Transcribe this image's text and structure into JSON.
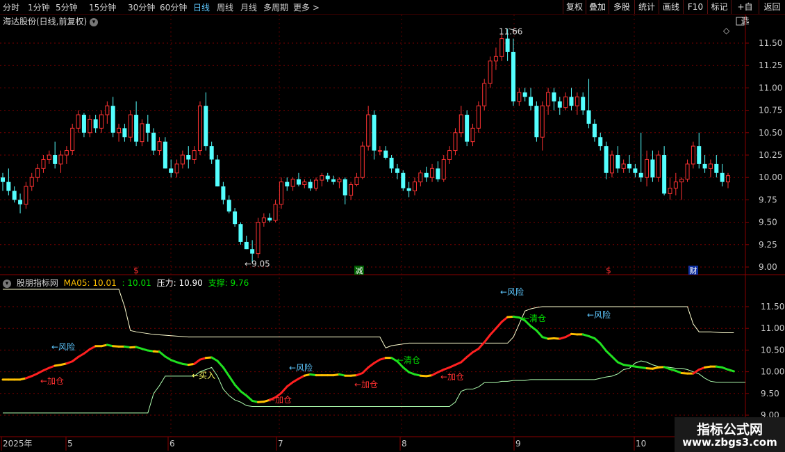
{
  "toolbar": {
    "periods": [
      {
        "label": "分时",
        "active": false
      },
      {
        "label": "1分钟",
        "active": false
      },
      {
        "label": "5分钟",
        "active": false
      },
      {
        "label": "15分钟",
        "active": false
      },
      {
        "label": "30分钟",
        "active": false
      },
      {
        "label": "60分钟",
        "active": false
      },
      {
        "label": "日线",
        "active": true
      },
      {
        "label": "周线",
        "active": false
      },
      {
        "label": "月线",
        "active": false
      },
      {
        "label": "多周期",
        "active": false
      },
      {
        "label": "更多 >",
        "active": false
      }
    ],
    "right_buttons": [
      "复权",
      "叠加",
      "多股",
      "统计",
      "画线",
      "F10",
      "标记",
      "+自选",
      "返回"
    ]
  },
  "main_chart": {
    "title": "海达股份(日线,前复权)",
    "y_ticks": [
      "11.50",
      "11.25",
      "11.00",
      "10.75",
      "10.50",
      "10.25",
      "10.00",
      "9.75",
      "9.50",
      "9.25",
      "9.00"
    ],
    "high_label": "11.66",
    "low_label": "9.05",
    "markers": [
      {
        "text": "$",
        "color": "#ff3030"
      },
      {
        "text": "减",
        "color": "#00c000"
      },
      {
        "text": "$",
        "color": "#ff3030"
      },
      {
        "text": "财",
        "color": "#3070ff"
      }
    ]
  },
  "indicator": {
    "name": "股朋指标网",
    "ma_label": "MA05: 10.01",
    "ma_value2": ": 10.01",
    "pressure_label": "压力: 10.90",
    "support_label": "支撑: 9.76",
    "y_ticks": [
      "11.50",
      "11.00",
      "10.50",
      "10.00",
      "9.50",
      "9.00"
    ],
    "annotations": [
      {
        "text": "←风险",
        "color": "#5ec8ff"
      },
      {
        "text": "←加仓",
        "color": "#ff3030"
      },
      {
        "text": "←买入",
        "color": "#ffff60"
      },
      {
        "text": "←加仓",
        "color": "#ff3030"
      },
      {
        "text": "←风险",
        "color": "#5ec8ff"
      },
      {
        "text": "←加仓",
        "color": "#ff3030"
      },
      {
        "text": "←清仓",
        "color": "#00e000"
      },
      {
        "text": "←加仓",
        "color": "#ff3030"
      },
      {
        "text": "←风险",
        "color": "#5ec8ff"
      },
      {
        "text": "←清仓",
        "color": "#00e000"
      },
      {
        "text": "←风险",
        "color": "#5ec8ff"
      }
    ]
  },
  "x_axis": [
    "2025年",
    "5",
    "6",
    "7",
    "8",
    "9",
    "10"
  ],
  "watermark": {
    "line1": "指标公式网",
    "line2": "www.zbgs3.com"
  },
  "colors": {
    "up": "#ff3232",
    "down": "#54ffff",
    "grid": "#7a0000",
    "pressure": "#ffffd0",
    "support": "#b0ffb0"
  },
  "chart_data": {
    "type": "candlestick",
    "ylim": [
      8.95,
      11.72
    ],
    "candles": [
      [
        10.0,
        10.05,
        9.85,
        9.95
      ],
      [
        9.95,
        10.1,
        9.8,
        9.85
      ],
      [
        9.85,
        9.9,
        9.72,
        9.75
      ],
      [
        9.75,
        9.82,
        9.6,
        9.7
      ],
      [
        9.7,
        9.95,
        9.65,
        9.9
      ],
      [
        9.9,
        10.05,
        9.85,
        10.0
      ],
      [
        10.0,
        10.15,
        9.95,
        10.1
      ],
      [
        10.1,
        10.25,
        10.05,
        10.2
      ],
      [
        10.2,
        10.3,
        10.15,
        10.25
      ],
      [
        10.25,
        10.4,
        10.1,
        10.15
      ],
      [
        10.15,
        10.3,
        10.05,
        10.25
      ],
      [
        10.25,
        10.35,
        10.15,
        10.3
      ],
      [
        10.3,
        10.6,
        10.25,
        10.55
      ],
      [
        10.55,
        10.75,
        10.5,
        10.7
      ],
      [
        10.7,
        10.72,
        10.45,
        10.5
      ],
      [
        10.5,
        10.7,
        10.45,
        10.65
      ],
      [
        10.65,
        10.7,
        10.5,
        10.55
      ],
      [
        10.55,
        10.75,
        10.5,
        10.7
      ],
      [
        10.7,
        10.85,
        10.6,
        10.8
      ],
      [
        10.8,
        10.9,
        10.45,
        10.5
      ],
      [
        10.5,
        10.6,
        10.4,
        10.55
      ],
      [
        10.55,
        10.6,
        10.4,
        10.45
      ],
      [
        10.45,
        10.75,
        10.4,
        10.7
      ],
      [
        10.7,
        10.85,
        10.35,
        10.4
      ],
      [
        10.4,
        10.65,
        10.35,
        10.6
      ],
      [
        10.6,
        10.7,
        10.4,
        10.5
      ],
      [
        10.5,
        10.55,
        10.25,
        10.3
      ],
      [
        10.3,
        10.45,
        10.25,
        10.4
      ],
      [
        10.4,
        10.45,
        10.1,
        10.1
      ],
      [
        10.1,
        10.2,
        10.0,
        10.05
      ],
      [
        10.05,
        10.2,
        10.0,
        10.15
      ],
      [
        10.15,
        10.3,
        10.1,
        10.25
      ],
      [
        10.25,
        10.35,
        10.1,
        10.2
      ],
      [
        10.2,
        10.35,
        10.15,
        10.3
      ],
      [
        10.3,
        10.85,
        10.25,
        10.8
      ],
      [
        10.8,
        10.95,
        10.3,
        10.35
      ],
      [
        10.35,
        10.4,
        10.15,
        10.2
      ],
      [
        10.2,
        10.25,
        9.9,
        9.9
      ],
      [
        9.9,
        9.95,
        9.7,
        9.75
      ],
      [
        9.75,
        9.8,
        9.6,
        9.62
      ],
      [
        9.62,
        9.66,
        9.45,
        9.48
      ],
      [
        9.48,
        9.5,
        9.25,
        9.28
      ],
      [
        9.28,
        9.35,
        9.2,
        9.2
      ],
      [
        9.2,
        9.3,
        9.05,
        9.15
      ],
      [
        9.15,
        9.55,
        9.1,
        9.5
      ],
      [
        9.5,
        9.6,
        9.45,
        9.55
      ],
      [
        9.55,
        9.6,
        9.5,
        9.52
      ],
      [
        9.52,
        9.75,
        9.5,
        9.7
      ],
      [
        9.7,
        10.0,
        9.65,
        9.95
      ],
      [
        9.95,
        10.0,
        9.85,
        9.9
      ],
      [
        9.9,
        10.0,
        9.85,
        9.98
      ],
      [
        9.98,
        10.05,
        9.9,
        9.92
      ],
      [
        9.92,
        9.98,
        9.88,
        9.95
      ],
      [
        9.95,
        9.98,
        9.85,
        9.88
      ],
      [
        9.88,
        10.0,
        9.85,
        9.97
      ],
      [
        9.97,
        10.05,
        9.9,
        10.02
      ],
      [
        10.02,
        10.05,
        9.95,
        9.98
      ],
      [
        9.98,
        10.02,
        9.92,
        9.95
      ],
      [
        9.95,
        10.0,
        9.88,
        9.98
      ],
      [
        9.98,
        10.0,
        9.7,
        9.8
      ],
      [
        9.8,
        9.95,
        9.75,
        9.92
      ],
      [
        9.92,
        10.05,
        9.9,
        10.0
      ],
      [
        10.0,
        10.4,
        9.98,
        10.35
      ],
      [
        10.35,
        10.8,
        10.3,
        10.7
      ],
      [
        10.7,
        10.75,
        10.2,
        10.3
      ],
      [
        10.3,
        10.35,
        10.25,
        10.3
      ],
      [
        10.3,
        10.35,
        10.2,
        10.22
      ],
      [
        10.22,
        10.25,
        10.05,
        10.1
      ],
      [
        10.1,
        10.15,
        9.98,
        10.05
      ],
      [
        10.05,
        10.08,
        9.85,
        9.88
      ],
      [
        9.88,
        9.95,
        9.78,
        9.85
      ],
      [
        9.85,
        10.0,
        9.8,
        9.95
      ],
      [
        9.95,
        10.08,
        9.9,
        10.05
      ],
      [
        10.05,
        10.12,
        9.95,
        10.0
      ],
      [
        10.0,
        10.15,
        9.95,
        10.1
      ],
      [
        10.1,
        10.18,
        9.95,
        9.98
      ],
      [
        9.98,
        10.25,
        9.95,
        10.2
      ],
      [
        10.2,
        10.35,
        10.15,
        10.3
      ],
      [
        10.3,
        10.55,
        10.25,
        10.5
      ],
      [
        10.5,
        10.8,
        10.45,
        10.7
      ],
      [
        10.7,
        10.75,
        10.35,
        10.4
      ],
      [
        10.4,
        10.6,
        10.35,
        10.55
      ],
      [
        10.55,
        10.85,
        10.5,
        10.8
      ],
      [
        10.8,
        11.1,
        10.75,
        11.05
      ],
      [
        11.05,
        11.35,
        11.0,
        11.3
      ],
      [
        11.3,
        11.45,
        11.2,
        11.35
      ],
      [
        11.35,
        11.6,
        11.3,
        11.55
      ],
      [
        11.55,
        11.66,
        11.3,
        11.4
      ],
      [
        11.4,
        11.55,
        10.8,
        10.85
      ],
      [
        10.85,
        11.0,
        10.8,
        10.95
      ],
      [
        10.95,
        11.0,
        10.85,
        10.9
      ],
      [
        10.9,
        11.0,
        10.75,
        10.8
      ],
      [
        10.8,
        10.85,
        10.4,
        10.45
      ],
      [
        10.45,
        10.85,
        10.3,
        10.8
      ],
      [
        10.8,
        11.0,
        10.7,
        10.95
      ],
      [
        10.95,
        11.0,
        10.75,
        10.85
      ],
      [
        10.85,
        10.9,
        10.7,
        10.78
      ],
      [
        10.78,
        10.95,
        10.75,
        10.9
      ],
      [
        10.9,
        11.0,
        10.75,
        10.8
      ],
      [
        10.8,
        10.95,
        10.7,
        10.9
      ],
      [
        10.9,
        10.95,
        10.7,
        10.75
      ],
      [
        10.75,
        11.1,
        10.55,
        10.6
      ],
      [
        10.6,
        10.65,
        10.4,
        10.45
      ],
      [
        10.45,
        10.5,
        10.3,
        10.35
      ],
      [
        10.35,
        10.4,
        9.98,
        10.05
      ],
      [
        10.05,
        10.3,
        10.0,
        10.25
      ],
      [
        10.25,
        10.35,
        10.05,
        10.1
      ],
      [
        10.1,
        10.2,
        10.05,
        10.15
      ],
      [
        10.15,
        10.25,
        10.05,
        10.1
      ],
      [
        10.1,
        10.15,
        10.0,
        10.05
      ],
      [
        10.05,
        10.5,
        9.95,
        10.0
      ],
      [
        10.0,
        10.3,
        9.9,
        10.2
      ],
      [
        10.2,
        10.3,
        9.95,
        10.0
      ],
      [
        10.0,
        10.3,
        9.95,
        10.25
      ],
      [
        10.25,
        10.35,
        9.8,
        9.82
      ],
      [
        9.82,
        10.0,
        9.75,
        9.88
      ],
      [
        9.88,
        10.05,
        9.8,
        9.95
      ],
      [
        9.95,
        10.0,
        9.75,
        9.98
      ],
      [
        9.98,
        10.2,
        9.95,
        10.15
      ],
      [
        10.15,
        10.4,
        10.1,
        10.35
      ],
      [
        10.35,
        10.5,
        10.1,
        10.15
      ],
      [
        10.15,
        10.25,
        10.05,
        10.1
      ],
      [
        10.1,
        10.2,
        10.0,
        10.15
      ],
      [
        10.15,
        10.25,
        10.0,
        10.05
      ],
      [
        10.05,
        10.15,
        9.9,
        9.95
      ],
      [
        9.95,
        10.05,
        9.88,
        10.02
      ]
    ],
    "indicator": {
      "ma": [
        9.82,
        9.82,
        9.82,
        9.82,
        9.85,
        9.9,
        9.96,
        10.03,
        10.09,
        10.14,
        10.16,
        10.19,
        10.24,
        10.34,
        10.42,
        10.52,
        10.59,
        10.59,
        10.62,
        10.59,
        10.58,
        10.58,
        10.56,
        10.57,
        10.53,
        10.49,
        10.47,
        10.46,
        10.35,
        10.27,
        10.22,
        10.18,
        10.16,
        10.18,
        10.28,
        10.32,
        10.33,
        10.25,
        10.1,
        9.9,
        9.7,
        9.55,
        9.45,
        9.33,
        9.3,
        9.31,
        9.35,
        9.41,
        9.51,
        9.66,
        9.76,
        9.84,
        9.91,
        9.94,
        9.92,
        9.92,
        9.92,
        9.92,
        9.94,
        9.91,
        9.91,
        9.92,
        9.97,
        10.1,
        10.2,
        10.28,
        10.32,
        10.32,
        10.24,
        10.1,
        9.99,
        9.94,
        9.91,
        9.9,
        9.92,
        9.99,
        10.05,
        10.1,
        10.16,
        10.22,
        10.34,
        10.45,
        10.53,
        10.68,
        10.85,
        11.0,
        11.15,
        11.26,
        11.27,
        11.25,
        11.18,
        11.05,
        10.95,
        10.8,
        10.76,
        10.77,
        10.76,
        10.8,
        10.87,
        10.86,
        10.86,
        10.82,
        10.77,
        10.65,
        10.48,
        10.35,
        10.22,
        10.16,
        10.14,
        10.12,
        10.1,
        10.08,
        10.07,
        10.1,
        10.11,
        10.06,
        10.02,
        9.97,
        9.96,
        9.96,
        10.05,
        10.1,
        10.12,
        10.12,
        10.1,
        10.05,
        10.01
      ],
      "pressure": [
        11.9,
        11.9,
        11.9,
        11.9,
        11.9,
        11.9,
        11.9,
        11.9,
        11.9,
        11.9,
        11.9,
        11.9,
        11.9,
        11.9,
        11.9,
        11.9,
        11.9,
        11.9,
        11.9,
        11.9,
        11.9,
        11.5,
        10.95,
        10.92,
        10.9,
        10.88,
        10.86,
        10.85,
        10.84,
        10.83,
        10.82,
        10.81,
        10.8,
        10.8,
        10.8,
        10.8,
        10.8,
        10.8,
        10.8,
        10.8,
        10.8,
        10.8,
        10.8,
        10.8,
        10.8,
        10.8,
        10.8,
        10.8,
        10.8,
        10.8,
        10.8,
        10.8,
        10.8,
        10.8,
        10.8,
        10.8,
        10.8,
        10.8,
        10.8,
        10.8,
        10.8,
        10.8,
        10.8,
        10.8,
        10.8,
        10.8,
        10.55,
        10.6,
        10.62,
        10.64,
        10.66,
        10.66,
        10.66,
        10.66,
        10.66,
        10.66,
        10.66,
        10.66,
        10.66,
        10.66,
        10.66,
        10.66,
        10.66,
        10.66,
        10.66,
        10.66,
        10.66,
        10.66,
        10.8,
        11.1,
        11.4,
        11.45,
        11.48,
        11.5,
        11.5,
        11.5,
        11.5,
        11.5,
        11.5,
        11.5,
        11.5,
        11.5,
        11.5,
        11.5,
        11.5,
        11.5,
        11.5,
        11.5,
        11.5,
        11.5,
        11.5,
        11.5,
        11.5,
        11.5,
        11.5,
        11.5,
        11.5,
        11.5,
        11.5,
        11.1,
        10.92,
        10.92,
        10.92,
        10.91,
        10.9,
        10.9,
        10.9
      ],
      "support": [
        9.05,
        9.05,
        9.05,
        9.05,
        9.05,
        9.05,
        9.05,
        9.05,
        9.05,
        9.05,
        9.05,
        9.05,
        9.05,
        9.05,
        9.05,
        9.05,
        9.05,
        9.05,
        9.05,
        9.05,
        9.05,
        9.05,
        9.05,
        9.05,
        9.05,
        9.05,
        9.5,
        9.68,
        9.9,
        9.9,
        9.9,
        9.9,
        9.9,
        9.9,
        10.0,
        10.05,
        10.1,
        9.9,
        9.6,
        9.45,
        9.35,
        9.3,
        9.22,
        9.2,
        9.2,
        9.2,
        9.2,
        9.2,
        9.2,
        9.2,
        9.2,
        9.2,
        9.2,
        9.2,
        9.2,
        9.2,
        9.2,
        9.2,
        9.2,
        9.2,
        9.2,
        9.2,
        9.2,
        9.2,
        9.2,
        9.2,
        9.2,
        9.2,
        9.2,
        9.2,
        9.2,
        9.2,
        9.2,
        9.2,
        9.2,
        9.2,
        9.2,
        9.2,
        9.3,
        9.55,
        9.6,
        9.6,
        9.65,
        9.75,
        9.75,
        9.75,
        9.78,
        9.78,
        9.8,
        9.8,
        9.8,
        9.82,
        9.82,
        9.82,
        9.82,
        9.82,
        9.82,
        9.82,
        9.82,
        9.82,
        9.82,
        9.82,
        9.82,
        9.85,
        9.88,
        9.9,
        9.95,
        10.05,
        10.08,
        10.2,
        10.25,
        10.22,
        10.16,
        10.12,
        10.12,
        10.1,
        10.08,
        10.08,
        10.05,
        10.0,
        9.95,
        9.85,
        9.78,
        9.76,
        9.76,
        9.76,
        9.76,
        9.76,
        9.76
      ]
    }
  }
}
